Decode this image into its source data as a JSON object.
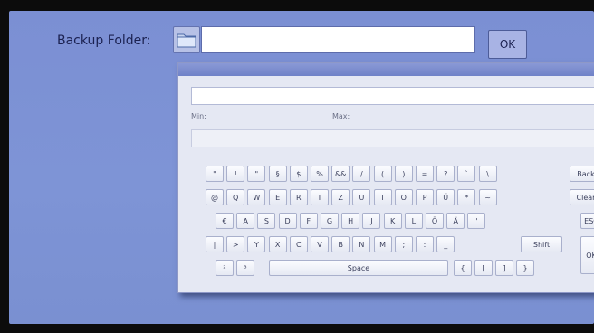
{
  "backup": {
    "label": "Backup Folder:",
    "path_value": "",
    "ok_label": "OK",
    "folder_icon": "folder-icon"
  },
  "keyboard": {
    "entry_value": "",
    "min_label": "Min:",
    "max_label": "Max:",
    "rows": [
      [
        "\"",
        "!",
        "\"",
        "§",
        "$",
        "%",
        "&&",
        "/",
        "(",
        ")",
        "=",
        "?",
        "`",
        "\\",
        "Back"
      ],
      [
        "@",
        "Q",
        "W",
        "E",
        "R",
        "T",
        "Z",
        "U",
        "I",
        "O",
        "P",
        "Ü",
        "*",
        "~",
        "Clear"
      ],
      [
        "€",
        "A",
        "S",
        "D",
        "F",
        "G",
        "H",
        "J",
        "K",
        "L",
        "Ö",
        "Ä",
        "'",
        "ESC"
      ],
      [
        "|",
        ">",
        "Y",
        "X",
        "C",
        "V",
        "B",
        "N",
        "M",
        ";",
        ":",
        "_",
        "Shift",
        "OK"
      ],
      [
        "²",
        "³",
        "Space",
        "{",
        "[",
        "]",
        "}"
      ]
    ]
  }
}
